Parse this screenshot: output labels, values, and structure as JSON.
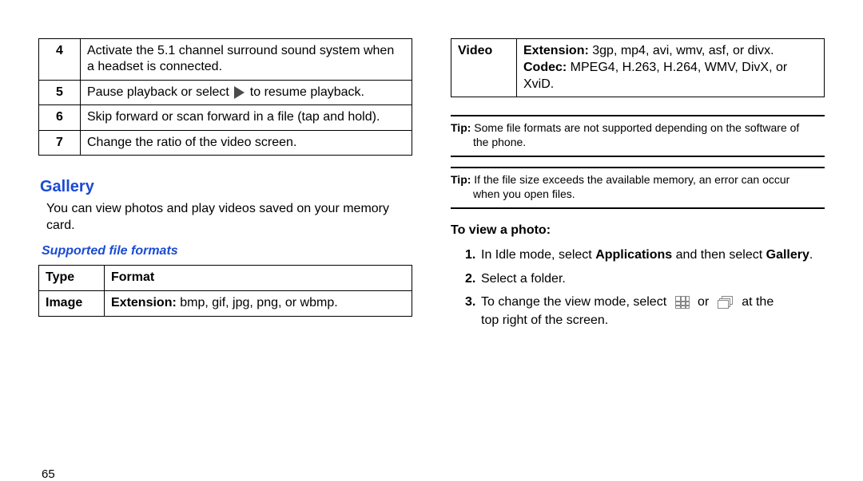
{
  "left": {
    "steps": [
      {
        "num": "4",
        "text_line1": "Activate the 5.1 channel surround sound system when",
        "text_line2": "a headset is connected."
      },
      {
        "num": "5",
        "text_before": "Pause playback or select ",
        "text_after": " to resume playback."
      },
      {
        "num": "6",
        "text": "Skip forward or scan forward in a file (tap and hold)."
      },
      {
        "num": "7",
        "text": "Change the ratio of the video screen."
      }
    ],
    "gallery_title": "Gallery",
    "gallery_body": "You can view photos and play videos saved on your memory card.",
    "supported_title": "Supported file formats",
    "format_table": {
      "headers": [
        "Type",
        "Format"
      ],
      "image_row": {
        "type": "Image",
        "label": "Extension:",
        "rest": " bmp, gif, jpg, png, or wbmp."
      }
    },
    "page_number": "65"
  },
  "right": {
    "video_row": {
      "type": "Video",
      "ext_label": "Extension:",
      "ext_rest": " 3gp, mp4, avi, wmv, asf, or divx.",
      "codec_label": "Codec:",
      "codec_rest": " MPEG4, H.263, H.264, WMV, DivX, or XviD."
    },
    "tip1": {
      "label": "Tip:",
      "text": " Some file formats are not supported depending on the software of",
      "text2": "the phone."
    },
    "tip2": {
      "label": "Tip:",
      "text": " If the file size exceeds the available memory, an error can occur",
      "text2": "when you open files."
    },
    "view_photo_heading": "To view a photo:",
    "steps": {
      "s1_n": "1.",
      "s1_a": "In Idle mode, select ",
      "s1_b": "Applications",
      "s1_c": " and then select ",
      "s1_d": "Gallery",
      "s1_e": ".",
      "s2_n": "2.",
      "s2": "Select a folder.",
      "s3_n": "3.",
      "s3_a": "To change the view mode, select",
      "s3_b": "or",
      "s3_c": "at the",
      "s3_d": "top right of the screen."
    }
  }
}
